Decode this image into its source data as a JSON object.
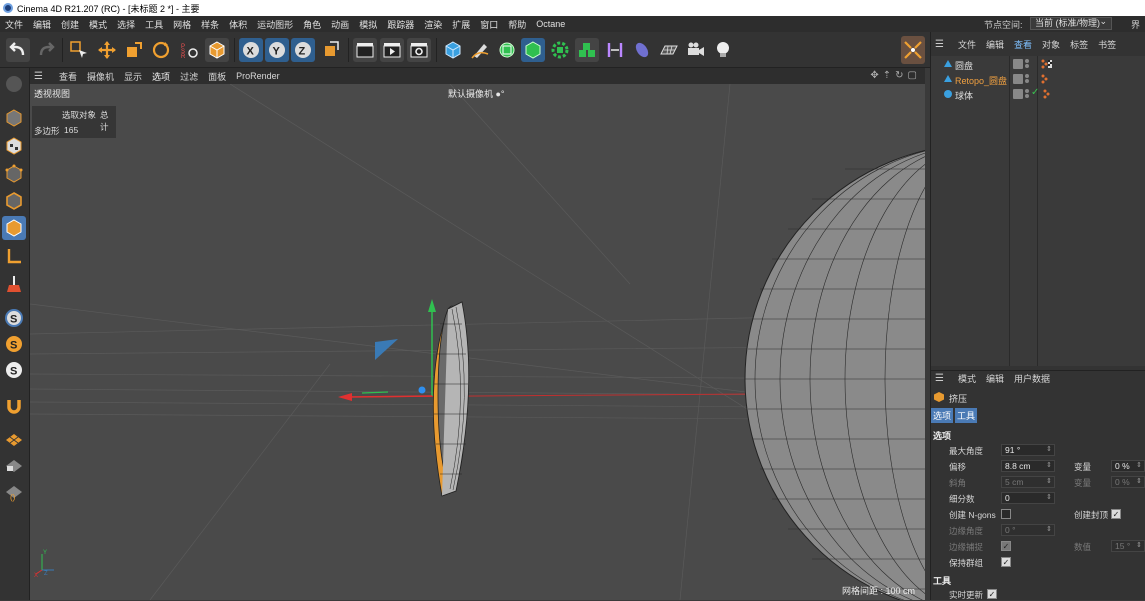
{
  "window": {
    "title": "Cinema 4D R21.207 (RC) - [未标题 2 *] - 主要"
  },
  "menubar": {
    "items": [
      "文件",
      "编辑",
      "创建",
      "模式",
      "选择",
      "工具",
      "网格",
      "样条",
      "体积",
      "运动图形",
      "角色",
      "动画",
      "模拟",
      "跟踪器",
      "渲染",
      "扩展",
      "窗口",
      "帮助",
      "Octane"
    ],
    "node_space_label": "节点空间:",
    "node_space_value": "当前 (标准/物理)",
    "more": "界"
  },
  "viewport_menu": {
    "items": [
      "查看",
      "摄像机",
      "显示",
      "选项",
      "过滤",
      "面板",
      "ProRender"
    ],
    "selected": "选项"
  },
  "viewport": {
    "title": "透视视图",
    "camera": "默认摄像机 ●°",
    "hud": {
      "h1": "选取对象",
      "h2": "总计",
      "h3": "多边形",
      "h4": "165"
    },
    "grid_spacing": "网格间距 : 100 cm",
    "axis_labels": {
      "y": "Y",
      "x": "X",
      "z": "Z"
    }
  },
  "object_manager": {
    "menu": [
      "文件",
      "编辑",
      "查看",
      "对象",
      "标签",
      "书签"
    ],
    "selected_menu": "查看",
    "objects": [
      {
        "name": "圆盘",
        "highlight": false
      },
      {
        "name": "Retopo_圆盘",
        "highlight": true
      },
      {
        "name": "球体",
        "highlight": false
      }
    ]
  },
  "attribute_manager": {
    "menu": [
      "模式",
      "编辑",
      "用户数据"
    ],
    "object_title": "挤压",
    "tabs": [
      "选项",
      "工具"
    ],
    "section_options": "选项",
    "section_tools": "工具",
    "props": {
      "max_angle_label": "最大角度",
      "max_angle_value": "91 °",
      "offset_label": "偏移",
      "offset_value": "8.8 cm",
      "variance_label": "变量",
      "variance_value": "0 %",
      "bevel_label": "斜角",
      "bevel_value": "5 cm",
      "variance2_label": "变量",
      "variance2_value": "0 %",
      "subdivision_label": "细分数",
      "subdivision_value": "0",
      "create_ngons_label": "创建 N-gons",
      "create_caps_label": "创建封顶",
      "edge_angle_label": "边缘角度",
      "edge_angle_value": "0 °",
      "edge_snap_label": "边缘捕捉",
      "count_label": "数值",
      "count_value": "15 °",
      "keep_groups_label": "保持群组",
      "realtime_label": "实时更新"
    }
  }
}
